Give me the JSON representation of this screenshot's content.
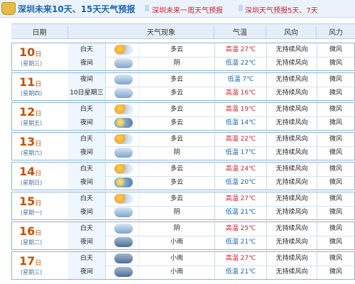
{
  "topbar": {
    "title": "深圳未来10天、15天天气预报",
    "links": [
      "深圳未来一周天气预报",
      "深圳天气预报5天、7天"
    ]
  },
  "header": {
    "date": "日期",
    "weather": "天气现象",
    "temp": "气温",
    "wind": "风向",
    "power": "风力"
  },
  "days": [
    {
      "date": "10",
      "unit": "日",
      "weekday": "(星期三)",
      "rows": [
        {
          "period": "白天",
          "icon": "sun-cloud",
          "desc": "多云",
          "templabel": "高温",
          "temp": "27℃",
          "wind": "无持续风向",
          "power": "微风"
        },
        {
          "period": "夜间",
          "icon": "cloud",
          "desc": "阴",
          "templabel": "低温",
          "temp": "22℃",
          "wind": "无持续风向",
          "power": "微风"
        }
      ]
    },
    {
      "date": "11",
      "unit": "日",
      "weekday": "(星期四)",
      "rows": [
        {
          "period": "夜间",
          "icon": "cloud",
          "desc": "多云",
          "templabel": "低温",
          "temp": "7℃",
          "wind": "无持续风向",
          "power": "微风"
        },
        {
          "period": "10日星期三",
          "icon": "cloud",
          "desc": "多云",
          "templabel": "高温",
          "temp": "16℃",
          "wind": "无持续风向",
          "power": "微风"
        }
      ]
    },
    {
      "date": "12",
      "unit": "日",
      "weekday": "(星期五)",
      "rows": [
        {
          "period": "白天",
          "icon": "sun-cloud",
          "desc": "多云",
          "templabel": "高温",
          "temp": "19℃",
          "wind": "无持续风向",
          "power": "微风"
        },
        {
          "period": "夜间",
          "icon": "moon",
          "desc": "多云",
          "templabel": "低温",
          "temp": "14℃",
          "wind": "无持续风向",
          "power": "微风"
        }
      ]
    },
    {
      "date": "13",
      "unit": "日",
      "weekday": "(星期六)",
      "rows": [
        {
          "period": "白天",
          "icon": "sun-cloud",
          "desc": "多云",
          "templabel": "高温",
          "temp": "22℃",
          "wind": "无持续风向",
          "power": "微风"
        },
        {
          "period": "夜间",
          "icon": "cloud",
          "desc": "阴",
          "templabel": "低温",
          "temp": "17℃",
          "wind": "无持续风向",
          "power": "微风"
        }
      ]
    },
    {
      "date": "14",
      "unit": "日",
      "weekday": "(星期日)",
      "rows": [
        {
          "period": "白天",
          "icon": "sun-cloud",
          "desc": "多云",
          "templabel": "高温",
          "temp": "24℃",
          "wind": "无持续风向",
          "power": "微风"
        },
        {
          "period": "夜间",
          "icon": "moon",
          "desc": "多云",
          "templabel": "低温",
          "temp": "20℃",
          "wind": "无持续风向",
          "power": "微风"
        }
      ]
    },
    {
      "date": "15",
      "unit": "日",
      "weekday": "(星期一)",
      "rows": [
        {
          "period": "白天",
          "icon": "sun-cloud",
          "desc": "多云",
          "templabel": "高温",
          "temp": "27℃",
          "wind": "无持续风向",
          "power": "微风"
        },
        {
          "period": "夜间",
          "icon": "cloud",
          "desc": "阴",
          "templabel": "低温",
          "temp": "21℃",
          "wind": "无持续风向",
          "power": "微风"
        }
      ]
    },
    {
      "date": "16",
      "unit": "日",
      "weekday": "(星期二)",
      "rows": [
        {
          "period": "白天",
          "icon": "cloud",
          "desc": "阴",
          "templabel": "高温",
          "temp": "25℃",
          "wind": "无持续风向",
          "power": "微风"
        },
        {
          "period": "夜间",
          "icon": "rain",
          "desc": "小雨",
          "templabel": "低温",
          "temp": "21℃",
          "wind": "无持续风向",
          "power": "微风"
        }
      ]
    },
    {
      "date": "17",
      "unit": "日",
      "weekday": "(星期三)",
      "rows": [
        {
          "period": "白天",
          "icon": "rain",
          "desc": "小雨",
          "templabel": "高温",
          "temp": "27℃",
          "wind": "无持续风向",
          "power": "微风"
        },
        {
          "period": "夜间",
          "icon": "rain",
          "desc": "小雨",
          "templabel": "低温",
          "temp": "21℃",
          "wind": "无持续风向",
          "power": "微风"
        }
      ]
    }
  ]
}
